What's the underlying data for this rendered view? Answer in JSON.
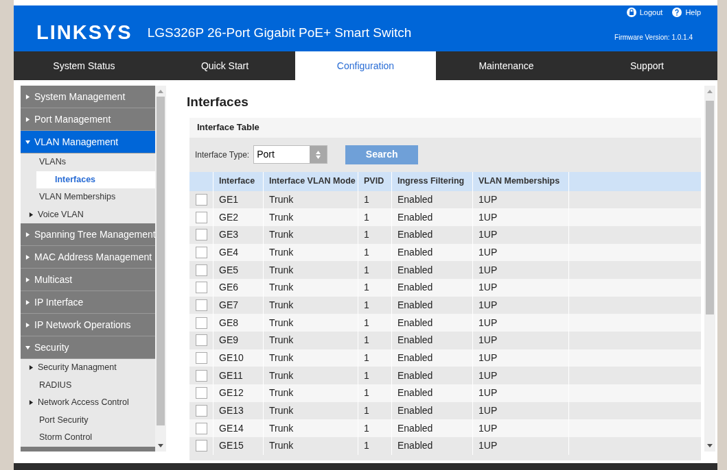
{
  "header": {
    "logo": "LINKSYS",
    "product": "LGS326P 26-Port Gigabit PoE+ Smart Switch",
    "links": [
      {
        "kind": "logout",
        "label": "Logout"
      },
      {
        "kind": "help",
        "label": "Help"
      }
    ],
    "firmware": "Firmware Version: 1.0.1.4"
  },
  "nav": [
    {
      "label": "System Status",
      "selected": false
    },
    {
      "label": "Quick Start",
      "selected": false
    },
    {
      "label": "Configuration",
      "selected": true
    },
    {
      "label": "Maintenance",
      "selected": false
    },
    {
      "label": "Support",
      "selected": false
    }
  ],
  "sidebar": [
    {
      "label": "System Management",
      "expanded": false,
      "selected": false
    },
    {
      "label": "Port Management",
      "expanded": false,
      "selected": false
    },
    {
      "label": "VLAN Management",
      "expanded": true,
      "selected": true,
      "children": [
        {
          "label": "VLANs",
          "selected": false,
          "has_children": false
        },
        {
          "label": "Interfaces",
          "selected": true,
          "has_children": false
        },
        {
          "label": "VLAN Memberships",
          "selected": false,
          "has_children": false
        },
        {
          "label": "Voice VLAN",
          "selected": false,
          "has_children": true
        }
      ]
    },
    {
      "label": "Spanning Tree Management",
      "expanded": false,
      "selected": false
    },
    {
      "label": "MAC Address Management",
      "expanded": false,
      "selected": false
    },
    {
      "label": "Multicast",
      "expanded": false,
      "selected": false
    },
    {
      "label": "IP Interface",
      "expanded": false,
      "selected": false
    },
    {
      "label": "IP Network Operations",
      "expanded": false,
      "selected": false
    },
    {
      "label": "Security",
      "expanded": true,
      "selected": false,
      "children": [
        {
          "label": "Security Managment",
          "selected": false,
          "has_children": true
        },
        {
          "label": "RADIUS",
          "selected": false,
          "has_children": false
        },
        {
          "label": "Network Access Control",
          "selected": false,
          "has_children": true
        },
        {
          "label": "Port Security",
          "selected": false,
          "has_children": false
        },
        {
          "label": "Storm Control",
          "selected": false,
          "has_children": false
        }
      ]
    }
  ],
  "page": {
    "title": "Interfaces",
    "section": "Interface Table",
    "filter": {
      "label": "Interface Type:",
      "value": "Port",
      "button": "Search"
    },
    "columns": [
      "Interface",
      "Interface VLAN Mode",
      "PVID",
      "Ingress Filtering",
      "VLAN Memberships"
    ],
    "rows": [
      {
        "checked": false,
        "cells": [
          "GE1",
          "Trunk",
          "1",
          "Enabled",
          "1UP"
        ]
      },
      {
        "checked": false,
        "cells": [
          "GE2",
          "Trunk",
          "1",
          "Enabled",
          "1UP"
        ]
      },
      {
        "checked": false,
        "cells": [
          "GE3",
          "Trunk",
          "1",
          "Enabled",
          "1UP"
        ]
      },
      {
        "checked": false,
        "cells": [
          "GE4",
          "Trunk",
          "1",
          "Enabled",
          "1UP"
        ]
      },
      {
        "checked": false,
        "cells": [
          "GE5",
          "Trunk",
          "1",
          "Enabled",
          "1UP"
        ]
      },
      {
        "checked": false,
        "cells": [
          "GE6",
          "Trunk",
          "1",
          "Enabled",
          "1UP"
        ]
      },
      {
        "checked": false,
        "cells": [
          "GE7",
          "Trunk",
          "1",
          "Enabled",
          "1UP"
        ]
      },
      {
        "checked": false,
        "cells": [
          "GE8",
          "Trunk",
          "1",
          "Enabled",
          "1UP"
        ]
      },
      {
        "checked": false,
        "cells": [
          "GE9",
          "Trunk",
          "1",
          "Enabled",
          "1UP"
        ]
      },
      {
        "checked": false,
        "cells": [
          "GE10",
          "Trunk",
          "1",
          "Enabled",
          "1UP"
        ]
      },
      {
        "checked": false,
        "cells": [
          "GE11",
          "Trunk",
          "1",
          "Enabled",
          "1UP"
        ]
      },
      {
        "checked": false,
        "cells": [
          "GE12",
          "Trunk",
          "1",
          "Enabled",
          "1UP"
        ]
      },
      {
        "checked": false,
        "cells": [
          "GE13",
          "Trunk",
          "1",
          "Enabled",
          "1UP"
        ]
      },
      {
        "checked": false,
        "cells": [
          "GE14",
          "Trunk",
          "1",
          "Enabled",
          "1UP"
        ]
      },
      {
        "checked": false,
        "cells": [
          "GE15",
          "Trunk",
          "1",
          "Enabled",
          "1UP"
        ]
      }
    ]
  }
}
